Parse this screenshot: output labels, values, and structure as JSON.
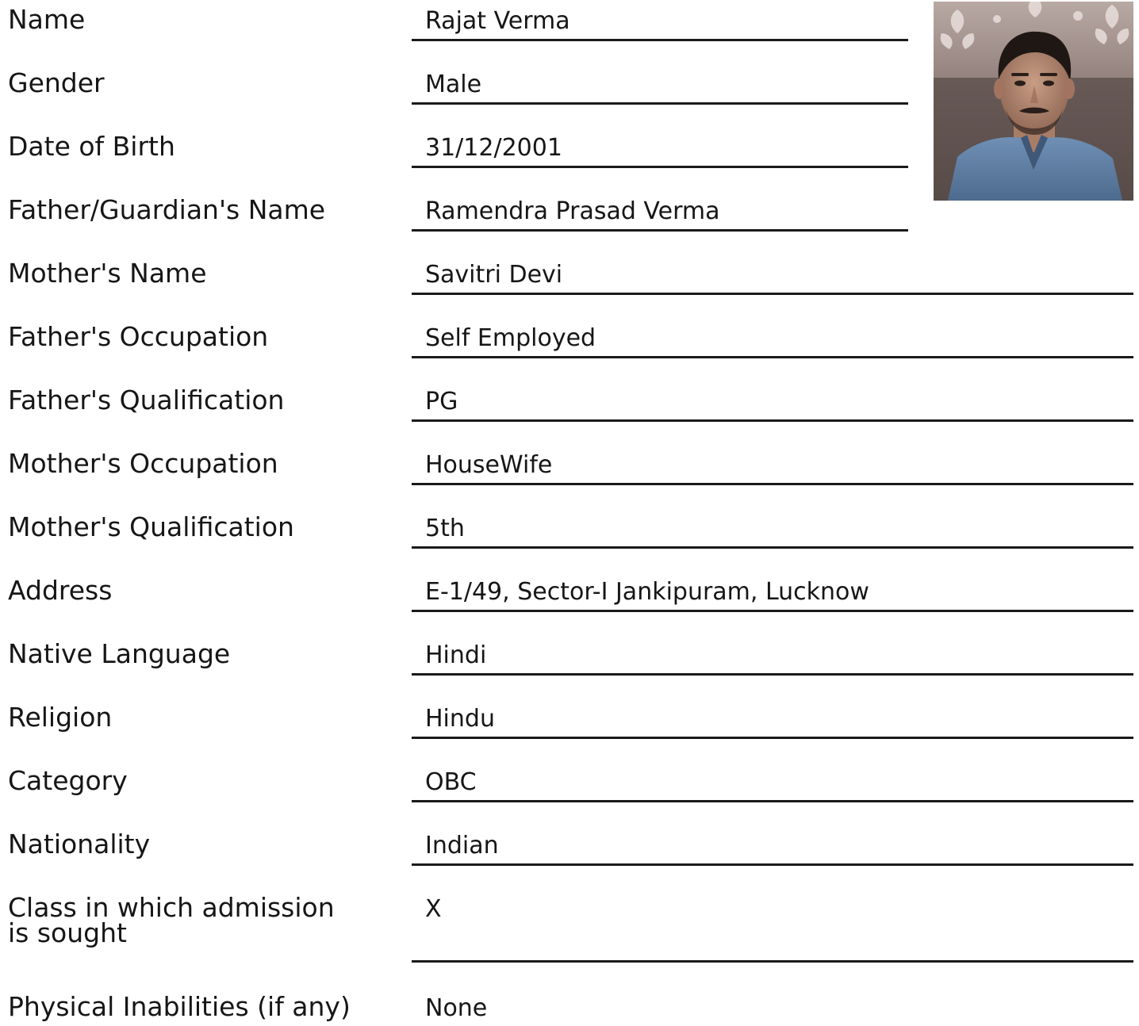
{
  "form": {
    "fields": [
      {
        "key": "name",
        "label": "Name",
        "value": "Rajat Verma"
      },
      {
        "key": "gender",
        "label": "Gender",
        "value": "Male"
      },
      {
        "key": "dob",
        "label": "Date of Birth",
        "value": "31/12/2001"
      },
      {
        "key": "father",
        "label": "Father/Guardian's Name",
        "value": "Ramendra Prasad Verma"
      },
      {
        "key": "mother",
        "label": "Mother's Name",
        "value": "Savitri Devi"
      },
      {
        "key": "father-occupation",
        "label": "Father's Occupation",
        "value": "Self Employed"
      },
      {
        "key": "father-qualification",
        "label": "Father's Qualification",
        "value": "PG"
      },
      {
        "key": "mother-occupation",
        "label": "Mother's Occupation",
        "value": "HouseWife"
      },
      {
        "key": "mother-qualification",
        "label": "Mother's Qualification",
        "value": "5th"
      },
      {
        "key": "address",
        "label": "Address",
        "value": "E-1/49, Sector-I Jankipuram, Lucknow"
      },
      {
        "key": "native-language",
        "label": "Native Language",
        "value": "Hindi"
      },
      {
        "key": "religion",
        "label": "Religion",
        "value": "Hindu"
      },
      {
        "key": "category",
        "label": "Category",
        "value": "OBC"
      },
      {
        "key": "nationality",
        "label": "Nationality",
        "value": "Indian"
      },
      {
        "key": "class-sought",
        "label": "Class in which admission is sought",
        "value": "X"
      },
      {
        "key": "physical-inabilities",
        "label": "Physical Inabilities (if any)",
        "value": "None"
      }
    ]
  },
  "colors": {
    "text": "#161616",
    "underline": "#1a1a1a",
    "background": "#ffffff"
  }
}
